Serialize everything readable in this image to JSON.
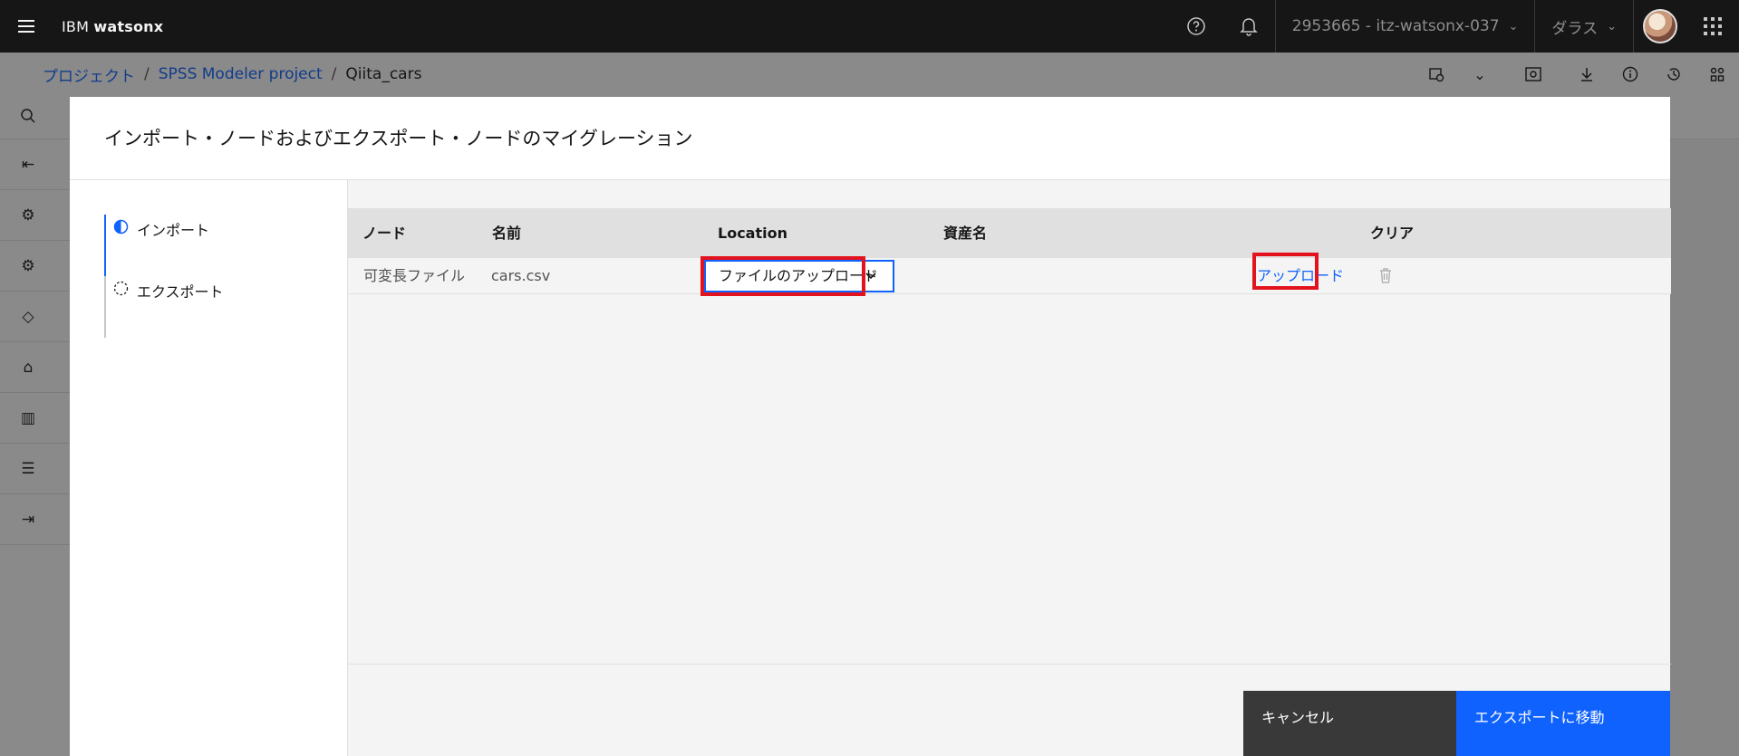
{
  "topbar": {
    "brand_prefix": "IBM ",
    "brand_product": "watsonx",
    "help_icon": "help-icon",
    "notification_icon": "bell-icon",
    "account": "2953665 - itz-watsonx-037",
    "region": "ダラス",
    "apps_icon": "app-switcher-icon"
  },
  "breadcrumb": {
    "items": [
      "プロジェクト",
      "SPSS Modeler project"
    ],
    "separator": "/",
    "current": "Qiita_cars"
  },
  "modal": {
    "title": "インポート・ノードおよびエクスポート・ノードのマイグレーション",
    "steps": [
      {
        "label": "インポート",
        "state": "current"
      },
      {
        "label": "エクスポート",
        "state": "incomplete"
      }
    ],
    "table": {
      "headers": [
        "ノード",
        "名前",
        "Location",
        "資産名",
        "クリア"
      ],
      "rows": [
        {
          "node": "可変長ファイル",
          "name": "cars.csv",
          "location": "ファイルのアップロード",
          "asset_name": "",
          "action": "アップロード"
        }
      ]
    },
    "buttons": {
      "cancel": "キャンセル",
      "primary": "エクスポートに移動"
    }
  },
  "colors": {
    "accent": "#0f62fe",
    "highlight": "#e3131e",
    "topbar": "#161616"
  }
}
